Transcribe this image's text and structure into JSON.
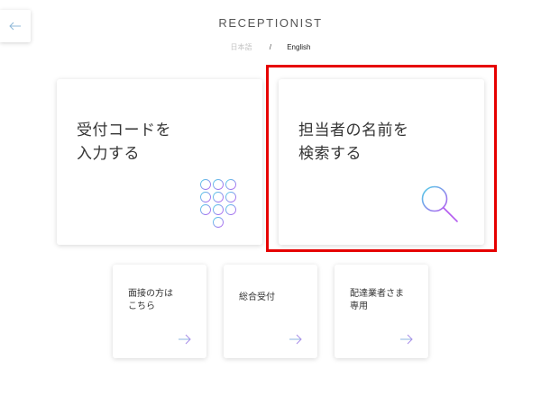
{
  "header": {
    "brand": "RECEPTIONIST",
    "back_icon": "arrow-left-icon"
  },
  "language": {
    "japanese": "日本語",
    "separator": "/",
    "english": "English",
    "selected": "English"
  },
  "main_cards": [
    {
      "label": "受付コードを\n入力する",
      "icon": "keypad-icon"
    },
    {
      "label": "担当者の名前を\n検索する",
      "icon": "search-icon",
      "highlighted": true
    }
  ],
  "sub_cards": [
    {
      "label": "面接の方は\nこちら",
      "icon": "arrow-right-icon"
    },
    {
      "label": "総合受付",
      "icon": "arrow-right-icon"
    },
    {
      "label": "配達業者さま\n専用",
      "icon": "arrow-right-icon"
    }
  ],
  "colors": {
    "highlight": "#e60000",
    "gradient_start": "#4fd1e6",
    "gradient_end": "#b45cf0"
  }
}
